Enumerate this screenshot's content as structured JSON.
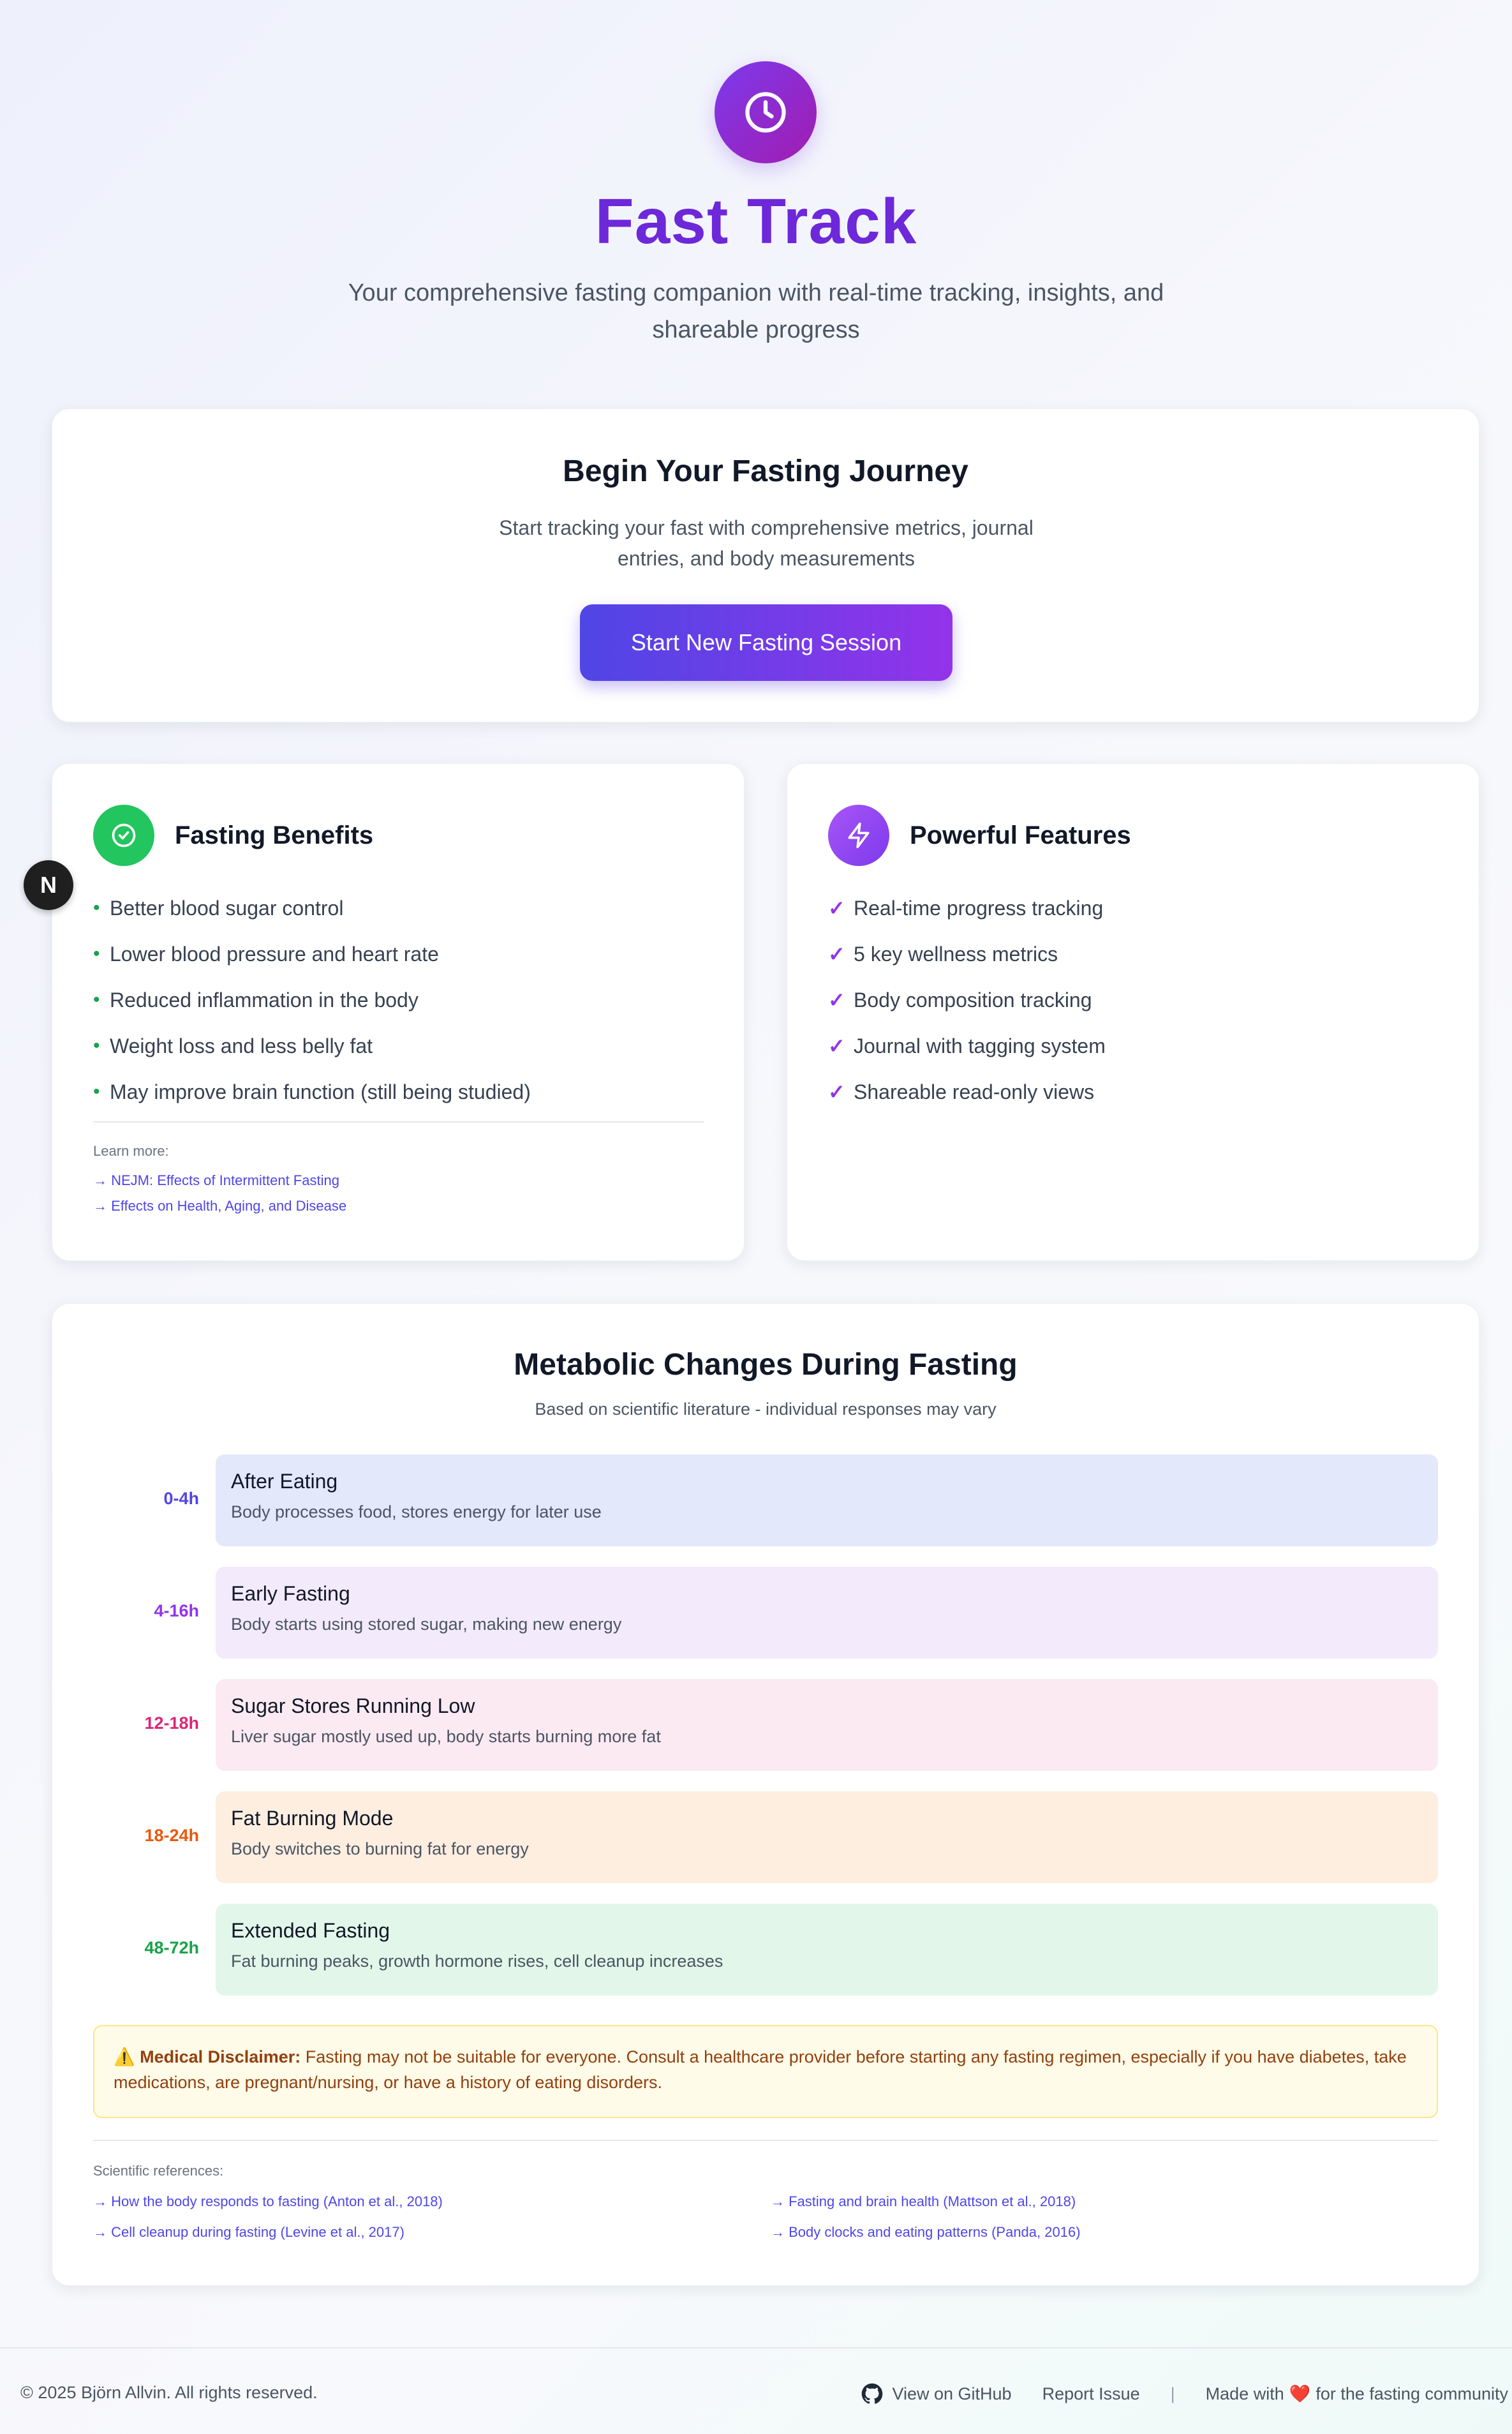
{
  "hero": {
    "icon": "clock-icon",
    "title": "Fast Track",
    "subtitle": "Your comprehensive fasting companion with real-time tracking, insights, and shareable progress"
  },
  "journey": {
    "title": "Begin Your Fasting Journey",
    "description": "Start tracking your fast with comprehensive metrics, journal entries, and body measurements",
    "button": "Start New Fasting Session"
  },
  "benefits": {
    "icon": "check-circle-icon",
    "title": "Fasting Benefits",
    "items": [
      "Better blood sugar control",
      "Lower blood pressure and heart rate",
      "Reduced inflammation in the body",
      "Weight loss and less belly fat",
      "May improve brain function (still being studied)"
    ],
    "learn_more_label": "Learn more:",
    "links": [
      "→ NEJM: Effects of Intermittent Fasting",
      "→ Effects on Health, Aging, and Disease"
    ]
  },
  "features": {
    "icon": "lightning-icon",
    "title": "Powerful Features",
    "items": [
      "Real-time progress tracking",
      "5 key wellness metrics",
      "Body composition tracking",
      "Journal with tagging system",
      "Shareable read-only views"
    ]
  },
  "dev_badge": "N",
  "metabolic": {
    "title": "Metabolic Changes During Fasting",
    "subtitle": "Based on scientific literature - individual responses may vary",
    "stages": [
      {
        "hours": "0-4h",
        "title": "After Eating",
        "description": "Body processes food, stores energy for later use",
        "color": "#4f46e5",
        "bg": "#e3e8fb"
      },
      {
        "hours": "4-16h",
        "title": "Early Fasting",
        "description": "Body starts using stored sugar, making new energy",
        "color": "#9333ea",
        "bg": "#f3eafc"
      },
      {
        "hours": "12-18h",
        "title": "Sugar Stores Running Low",
        "description": "Liver sugar mostly used up, body starts burning more fat",
        "color": "#db2777",
        "bg": "#fceaf3"
      },
      {
        "hours": "18-24h",
        "title": "Fat Burning Mode",
        "description": "Body switches to burning fat for energy",
        "color": "#ea580c",
        "bg": "#fdeee0"
      },
      {
        "hours": "48-72h",
        "title": "Extended Fasting",
        "description": "Fat burning peaks, growth hormone rises, cell cleanup increases",
        "color": "#16a34a",
        "bg": "#e2f7e9"
      }
    ],
    "disclaimer_label": "Medical Disclaimer:",
    "disclaimer_text": "Fasting may not be suitable for everyone. Consult a healthcare provider before starting any fasting regimen, especially if you have diabetes, take medications, are pregnant/nursing, or have a history of eating disorders.",
    "references_label": "Scientific references:",
    "references": [
      "→ How the body responds to fasting (Anton et al., 2018)",
      "→ Fasting and brain health (Mattson et al., 2018)",
      "→ Cell cleanup during fasting (Levine et al., 2017)",
      "→ Body clocks and eating patterns (Panda, 2016)"
    ]
  },
  "footer": {
    "copyright": "© 2025 Björn Allvin. All rights reserved.",
    "github": "View on GitHub",
    "report": "Report Issue",
    "separator": "|",
    "made_with_prefix": "Made with",
    "heart": "❤️",
    "made_with_suffix": "for the fasting community"
  }
}
